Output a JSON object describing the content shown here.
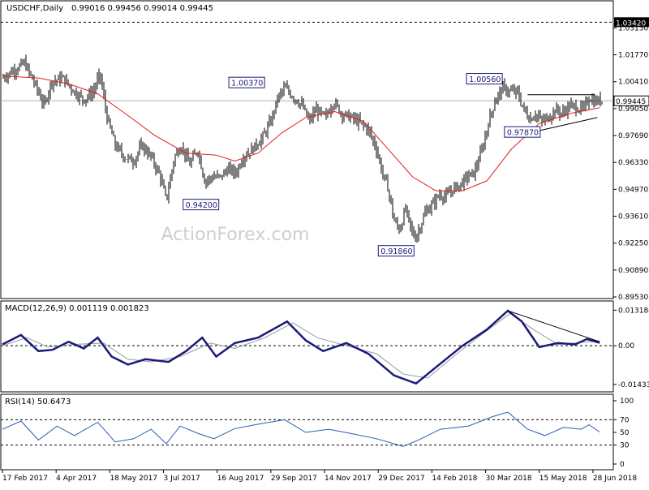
{
  "chart_data": [
    {
      "panel": "price",
      "type": "ohlc",
      "title": "USDCHF,Daily",
      "ohlc_header": "0.99016 0.99456 0.99014 0.99445",
      "ylim": [
        0.8953,
        1.0372
      ],
      "y_ticks": [
        "1.03130",
        "1.01770",
        "1.00410",
        "0.99050",
        "0.97690",
        "0.96330",
        "0.94970",
        "0.93610",
        "0.92250",
        "0.90890",
        "0.89530"
      ],
      "highlight_level": {
        "label": "1.03420",
        "value": 1.0342
      },
      "current_price": {
        "label": "0.99445",
        "value": 0.99445
      },
      "x_ticks": [
        "17 Feb 2017",
        "4 Apr 2017",
        "18 May 2017",
        "3 Jul 2017",
        "16 Aug 2017",
        "29 Sep 2017",
        "14 Nov 2017",
        "29 Dec 2017",
        "14 Feb 2018",
        "30 Mar 2018",
        "15 May 2018",
        "28 Jun 2018"
      ],
      "annotations": [
        {
          "label": "1.00370",
          "value": 1.0037
        },
        {
          "label": "0.94200",
          "value": 0.942
        },
        {
          "label": "0.91860",
          "value": 0.9186
        },
        {
          "label": "1.00560",
          "value": 1.0056
        },
        {
          "label": "0.97870",
          "value": 0.9787
        }
      ],
      "price_path": [
        {
          "date": "2017-02-17",
          "close": 1.006
        },
        {
          "date": "2017-02-27",
          "close": 1.01
        },
        {
          "date": "2017-03-08",
          "close": 1.0135
        },
        {
          "date": "2017-03-16",
          "close": 1.004
        },
        {
          "date": "2017-03-25",
          "close": 0.992
        },
        {
          "date": "2017-03-31",
          "close": 1.004
        },
        {
          "date": "2017-04-10",
          "close": 1.006
        },
        {
          "date": "2017-04-20",
          "close": 0.999
        },
        {
          "date": "2017-04-28",
          "close": 0.995
        },
        {
          "date": "2017-05-06",
          "close": 0.999
        },
        {
          "date": "2017-05-12",
          "close": 1.008
        },
        {
          "date": "2017-05-18",
          "close": 0.986
        },
        {
          "date": "2017-05-25",
          "close": 0.972
        },
        {
          "date": "2017-06-02",
          "close": 0.966
        },
        {
          "date": "2017-06-10",
          "close": 0.964
        },
        {
          "date": "2017-06-17",
          "close": 0.972
        },
        {
          "date": "2017-06-25",
          "close": 0.966
        },
        {
          "date": "2017-07-03",
          "close": 0.956
        },
        {
          "date": "2017-07-08",
          "close": 0.944
        },
        {
          "date": "2017-07-15",
          "close": 0.966
        },
        {
          "date": "2017-07-21",
          "close": 0.972
        },
        {
          "date": "2017-07-28",
          "close": 0.962
        },
        {
          "date": "2017-08-04",
          "close": 0.97
        },
        {
          "date": "2017-08-10",
          "close": 0.954
        },
        {
          "date": "2017-08-18",
          "close": 0.956
        },
        {
          "date": "2017-08-24",
          "close": 0.956
        },
        {
          "date": "2017-08-30",
          "close": 0.96
        },
        {
          "date": "2017-09-06",
          "close": 0.958
        },
        {
          "date": "2017-09-12",
          "close": 0.966
        },
        {
          "date": "2017-09-20",
          "close": 0.97
        },
        {
          "date": "2017-09-29",
          "close": 0.976
        },
        {
          "date": "2017-10-06",
          "close": 0.984
        },
        {
          "date": "2017-10-12",
          "close": 0.996
        },
        {
          "date": "2017-10-18",
          "close": 1.001
        },
        {
          "date": "2017-10-26",
          "close": 0.996
        },
        {
          "date": "2017-11-02",
          "close": 0.992
        },
        {
          "date": "2017-11-08",
          "close": 0.984
        },
        {
          "date": "2017-11-14",
          "close": 0.99
        },
        {
          "date": "2017-11-22",
          "close": 0.986
        },
        {
          "date": "2017-11-29",
          "close": 0.994
        },
        {
          "date": "2017-12-06",
          "close": 0.988
        },
        {
          "date": "2017-12-14",
          "close": 0.986
        },
        {
          "date": "2017-12-20",
          "close": 0.984
        },
        {
          "date": "2017-12-29",
          "close": 0.98
        },
        {
          "date": "2018-01-05",
          "close": 0.97
        },
        {
          "date": "2018-01-10",
          "close": 0.958
        },
        {
          "date": "2018-01-15",
          "close": 0.95
        },
        {
          "date": "2018-01-20",
          "close": 0.934
        },
        {
          "date": "2018-01-25",
          "close": 0.929
        },
        {
          "date": "2018-01-30",
          "close": 0.94
        },
        {
          "date": "2018-02-03",
          "close": 0.931
        },
        {
          "date": "2018-02-07",
          "close": 0.925
        },
        {
          "date": "2018-02-11",
          "close": 0.93
        },
        {
          "date": "2018-02-16",
          "close": 0.938
        },
        {
          "date": "2018-02-22",
          "close": 0.942
        },
        {
          "date": "2018-02-28",
          "close": 0.947
        },
        {
          "date": "2018-03-06",
          "close": 0.946
        },
        {
          "date": "2018-03-12",
          "close": 0.95
        },
        {
          "date": "2018-03-18",
          "close": 0.952
        },
        {
          "date": "2018-03-24",
          "close": 0.956
        },
        {
          "date": "2018-03-30",
          "close": 0.958
        },
        {
          "date": "2018-04-06",
          "close": 0.97
        },
        {
          "date": "2018-04-12",
          "close": 0.985
        },
        {
          "date": "2018-04-18",
          "close": 0.996
        },
        {
          "date": "2018-04-24",
          "close": 1.001
        },
        {
          "date": "2018-04-30",
          "close": 0.999
        },
        {
          "date": "2018-05-06",
          "close": 0.999
        },
        {
          "date": "2018-05-11",
          "close": 0.991
        },
        {
          "date": "2018-05-17",
          "close": 0.985
        },
        {
          "date": "2018-05-22",
          "close": 0.988
        },
        {
          "date": "2018-05-27",
          "close": 0.984
        },
        {
          "date": "2018-06-02",
          "close": 0.986
        },
        {
          "date": "2018-06-08",
          "close": 0.99
        },
        {
          "date": "2018-06-14",
          "close": 0.988
        },
        {
          "date": "2018-06-20",
          "close": 0.992
        },
        {
          "date": "2018-06-26",
          "close": 0.991
        },
        {
          "date": "2018-07-02",
          "close": 0.99
        },
        {
          "date": "2018-07-07",
          "close": 0.996
        },
        {
          "date": "2018-07-11",
          "close": 0.994
        },
        {
          "date": "2018-07-16",
          "close": 0.9945
        }
      ],
      "moving_average": [
        {
          "date": "2017-02-17",
          "value": 1.007
        },
        {
          "date": "2017-03-20",
          "value": 1.006
        },
        {
          "date": "2017-04-15",
          "value": 1.003
        },
        {
          "date": "2017-05-10",
          "value": 0.998
        },
        {
          "date": "2017-06-05",
          "value": 0.987
        },
        {
          "date": "2017-06-28",
          "value": 0.977
        },
        {
          "date": "2017-07-25",
          "value": 0.968
        },
        {
          "date": "2017-08-20",
          "value": 0.967
        },
        {
          "date": "2017-09-05",
          "value": 0.964
        },
        {
          "date": "2017-09-25",
          "value": 0.968
        },
        {
          "date": "2017-10-15",
          "value": 0.978
        },
        {
          "date": "2017-11-05",
          "value": 0.986
        },
        {
          "date": "2017-11-30",
          "value": 0.989
        },
        {
          "date": "2017-12-25",
          "value": 0.984
        },
        {
          "date": "2018-01-15",
          "value": 0.97
        },
        {
          "date": "2018-02-05",
          "value": 0.956
        },
        {
          "date": "2018-02-25",
          "value": 0.949
        },
        {
          "date": "2018-03-20",
          "value": 0.949
        },
        {
          "date": "2018-04-10",
          "value": 0.954
        },
        {
          "date": "2018-05-01",
          "value": 0.97
        },
        {
          "date": "2018-05-25",
          "value": 0.983
        },
        {
          "date": "2018-06-20",
          "value": 0.988
        },
        {
          "date": "2018-07-16",
          "value": 0.991
        }
      ],
      "colors": {
        "price": "#000000",
        "moving_average": "#e02020",
        "level_line": "#000000"
      }
    },
    {
      "panel": "macd",
      "type": "line",
      "title": "MACD(12,26,9) 0.001119 0.001823",
      "ylim": [
        -0.0165,
        0.0145
      ],
      "y_ticks": [
        {
          "label": "0.013184",
          "value": 0.013184
        },
        {
          "label": "0.00",
          "value": 0.0
        },
        {
          "label": "-0.014339",
          "value": -0.014339
        }
      ],
      "series": [
        {
          "name": "",
          "color": "#1a1a7a",
          "points": [
            {
              "date": "2017-02-17",
              "value": 0.0005
            },
            {
              "date": "2017-03-05",
              "value": 0.004
            },
            {
              "date": "2017-03-20",
              "value": -0.002
            },
            {
              "date": "2017-04-01",
              "value": -0.0015
            },
            {
              "date": "2017-04-15",
              "value": 0.0015
            },
            {
              "date": "2017-04-28",
              "value": -0.001
            },
            {
              "date": "2017-05-10",
              "value": 0.003
            },
            {
              "date": "2017-05-22",
              "value": -0.004
            },
            {
              "date": "2017-06-05",
              "value": -0.007
            },
            {
              "date": "2017-06-20",
              "value": -0.005
            },
            {
              "date": "2017-07-10",
              "value": -0.006
            },
            {
              "date": "2017-07-25",
              "value": -0.002
            },
            {
              "date": "2017-08-08",
              "value": 0.003
            },
            {
              "date": "2017-08-20",
              "value": -0.004
            },
            {
              "date": "2017-09-05",
              "value": 0.001
            },
            {
              "date": "2017-09-25",
              "value": 0.003
            },
            {
              "date": "2017-10-20",
              "value": 0.009
            },
            {
              "date": "2017-11-05",
              "value": 0.002
            },
            {
              "date": "2017-11-20",
              "value": -0.002
            },
            {
              "date": "2017-12-10",
              "value": 0.001
            },
            {
              "date": "2017-12-29",
              "value": -0.003
            },
            {
              "date": "2018-01-20",
              "value": -0.011
            },
            {
              "date": "2018-02-08",
              "value": -0.014
            },
            {
              "date": "2018-02-25",
              "value": -0.008
            },
            {
              "date": "2018-03-20",
              "value": 0.0
            },
            {
              "date": "2018-04-10",
              "value": 0.006
            },
            {
              "date": "2018-04-28",
              "value": 0.013
            },
            {
              "date": "2018-05-10",
              "value": 0.009
            },
            {
              "date": "2018-05-25",
              "value": -0.0005
            },
            {
              "date": "2018-06-10",
              "value": 0.001
            },
            {
              "date": "2018-06-25",
              "value": 0.0005
            },
            {
              "date": "2018-07-05",
              "value": 0.0025
            },
            {
              "date": "2018-07-16",
              "value": 0.0011
            }
          ]
        },
        {
          "name": "",
          "color": "#9a9a9a",
          "points": [
            {
              "date": "2017-02-17",
              "value": 0.0
            },
            {
              "date": "2017-03-10",
              "value": 0.003
            },
            {
              "date": "2017-03-28",
              "value": -0.0005
            },
            {
              "date": "2017-04-20",
              "value": 0.0005
            },
            {
              "date": "2017-05-15",
              "value": 0.001
            },
            {
              "date": "2017-06-05",
              "value": -0.005
            },
            {
              "date": "2017-06-25",
              "value": -0.006
            },
            {
              "date": "2017-07-20",
              "value": -0.004
            },
            {
              "date": "2017-08-15",
              "value": 0.001
            },
            {
              "date": "2017-09-05",
              "value": -0.001
            },
            {
              "date": "2017-10-01",
              "value": 0.003
            },
            {
              "date": "2017-10-25",
              "value": 0.0085
            },
            {
              "date": "2017-11-15",
              "value": 0.003
            },
            {
              "date": "2017-12-10",
              "value": 0.0
            },
            {
              "date": "2018-01-05",
              "value": -0.003
            },
            {
              "date": "2018-01-28",
              "value": -0.0105
            },
            {
              "date": "2018-02-18",
              "value": -0.012
            },
            {
              "date": "2018-03-15",
              "value": -0.003
            },
            {
              "date": "2018-04-05",
              "value": 0.004
            },
            {
              "date": "2018-04-30",
              "value": 0.012
            },
            {
              "date": "2018-05-20",
              "value": 0.006
            },
            {
              "date": "2018-06-10",
              "value": 0.0005
            },
            {
              "date": "2018-07-16",
              "value": 0.0018
            }
          ]
        }
      ],
      "trend_line": {
        "from": {
          "date": "2018-04-28",
          "value": 0.013
        },
        "to": {
          "date": "2018-07-16",
          "value": 0.0015
        }
      }
    },
    {
      "panel": "rsi",
      "type": "line",
      "title": "RSI(14) 50.6473",
      "ylim": [
        0,
        100
      ],
      "y_ticks": [
        {
          "label": "100",
          "value": 100
        },
        {
          "label": "70",
          "value": 70
        },
        {
          "label": "50",
          "value": 50
        },
        {
          "label": "30",
          "value": 30
        },
        {
          "label": "0",
          "value": 0
        }
      ],
      "levels": [
        70,
        30
      ],
      "series": [
        {
          "name": "",
          "color": "#2a5db0",
          "points": [
            {
              "date": "2017-02-17",
              "value": 55
            },
            {
              "date": "2017-03-05",
              "value": 68
            },
            {
              "date": "2017-03-20",
              "value": 38
            },
            {
              "date": "2017-04-05",
              "value": 60
            },
            {
              "date": "2017-04-20",
              "value": 45
            },
            {
              "date": "2017-05-10",
              "value": 66
            },
            {
              "date": "2017-05-25",
              "value": 35
            },
            {
              "date": "2017-06-10",
              "value": 40
            },
            {
              "date": "2017-06-25",
              "value": 55
            },
            {
              "date": "2017-07-08",
              "value": 32
            },
            {
              "date": "2017-07-20",
              "value": 60
            },
            {
              "date": "2017-08-05",
              "value": 48
            },
            {
              "date": "2017-08-18",
              "value": 40
            },
            {
              "date": "2017-09-05",
              "value": 56
            },
            {
              "date": "2017-09-28",
              "value": 64
            },
            {
              "date": "2017-10-18",
              "value": 70
            },
            {
              "date": "2017-11-05",
              "value": 50
            },
            {
              "date": "2017-11-25",
              "value": 55
            },
            {
              "date": "2017-12-15",
              "value": 48
            },
            {
              "date": "2018-01-05",
              "value": 40
            },
            {
              "date": "2018-01-28",
              "value": 28
            },
            {
              "date": "2018-02-10",
              "value": 38
            },
            {
              "date": "2018-03-01",
              "value": 55
            },
            {
              "date": "2018-03-25",
              "value": 60
            },
            {
              "date": "2018-04-15",
              "value": 75
            },
            {
              "date": "2018-04-28",
              "value": 82
            },
            {
              "date": "2018-05-15",
              "value": 55
            },
            {
              "date": "2018-05-30",
              "value": 45
            },
            {
              "date": "2018-06-15",
              "value": 58
            },
            {
              "date": "2018-06-30",
              "value": 55
            },
            {
              "date": "2018-07-07",
              "value": 62
            },
            {
              "date": "2018-07-16",
              "value": 50.6
            }
          ]
        }
      ]
    }
  ],
  "watermark": "ActionForex.com"
}
